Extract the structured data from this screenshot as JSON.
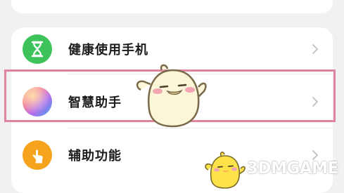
{
  "settings_list": {
    "items": [
      {
        "label": "健康使用手机",
        "icon": "hourglass-icon"
      },
      {
        "label": "智慧助手",
        "icon": "gradient-orb-icon"
      },
      {
        "label": "辅助功能",
        "icon": "hand-tap-icon"
      }
    ]
  },
  "colors": {
    "page_background": "#f1f1f3",
    "card": "#ffffff",
    "healthy_icon": "#3ec35a",
    "accessibility_icon": "#f5a21c",
    "highlight_border": "#e0839d"
  },
  "watermark": "3DMGAME"
}
